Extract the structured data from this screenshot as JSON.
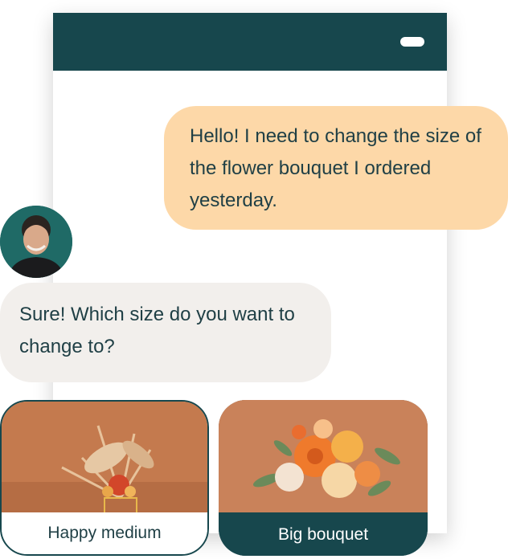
{
  "conversation": {
    "user_message": "Hello! I need to change the size of the flower bouquet I ordered yesterday.",
    "agent_message": "Sure! Which size do you want to change to?"
  },
  "options": [
    {
      "label": "Happy medium",
      "icon": "flower-bouquet-small-image",
      "selected": false
    },
    {
      "label": "Big bouquet",
      "icon": "flower-bouquet-large-image",
      "selected": true
    }
  ],
  "colors": {
    "header": "#17474d",
    "user_bubble": "#fdd8a8",
    "agent_bubble": "#f2efec",
    "text": "#1f3f45"
  }
}
